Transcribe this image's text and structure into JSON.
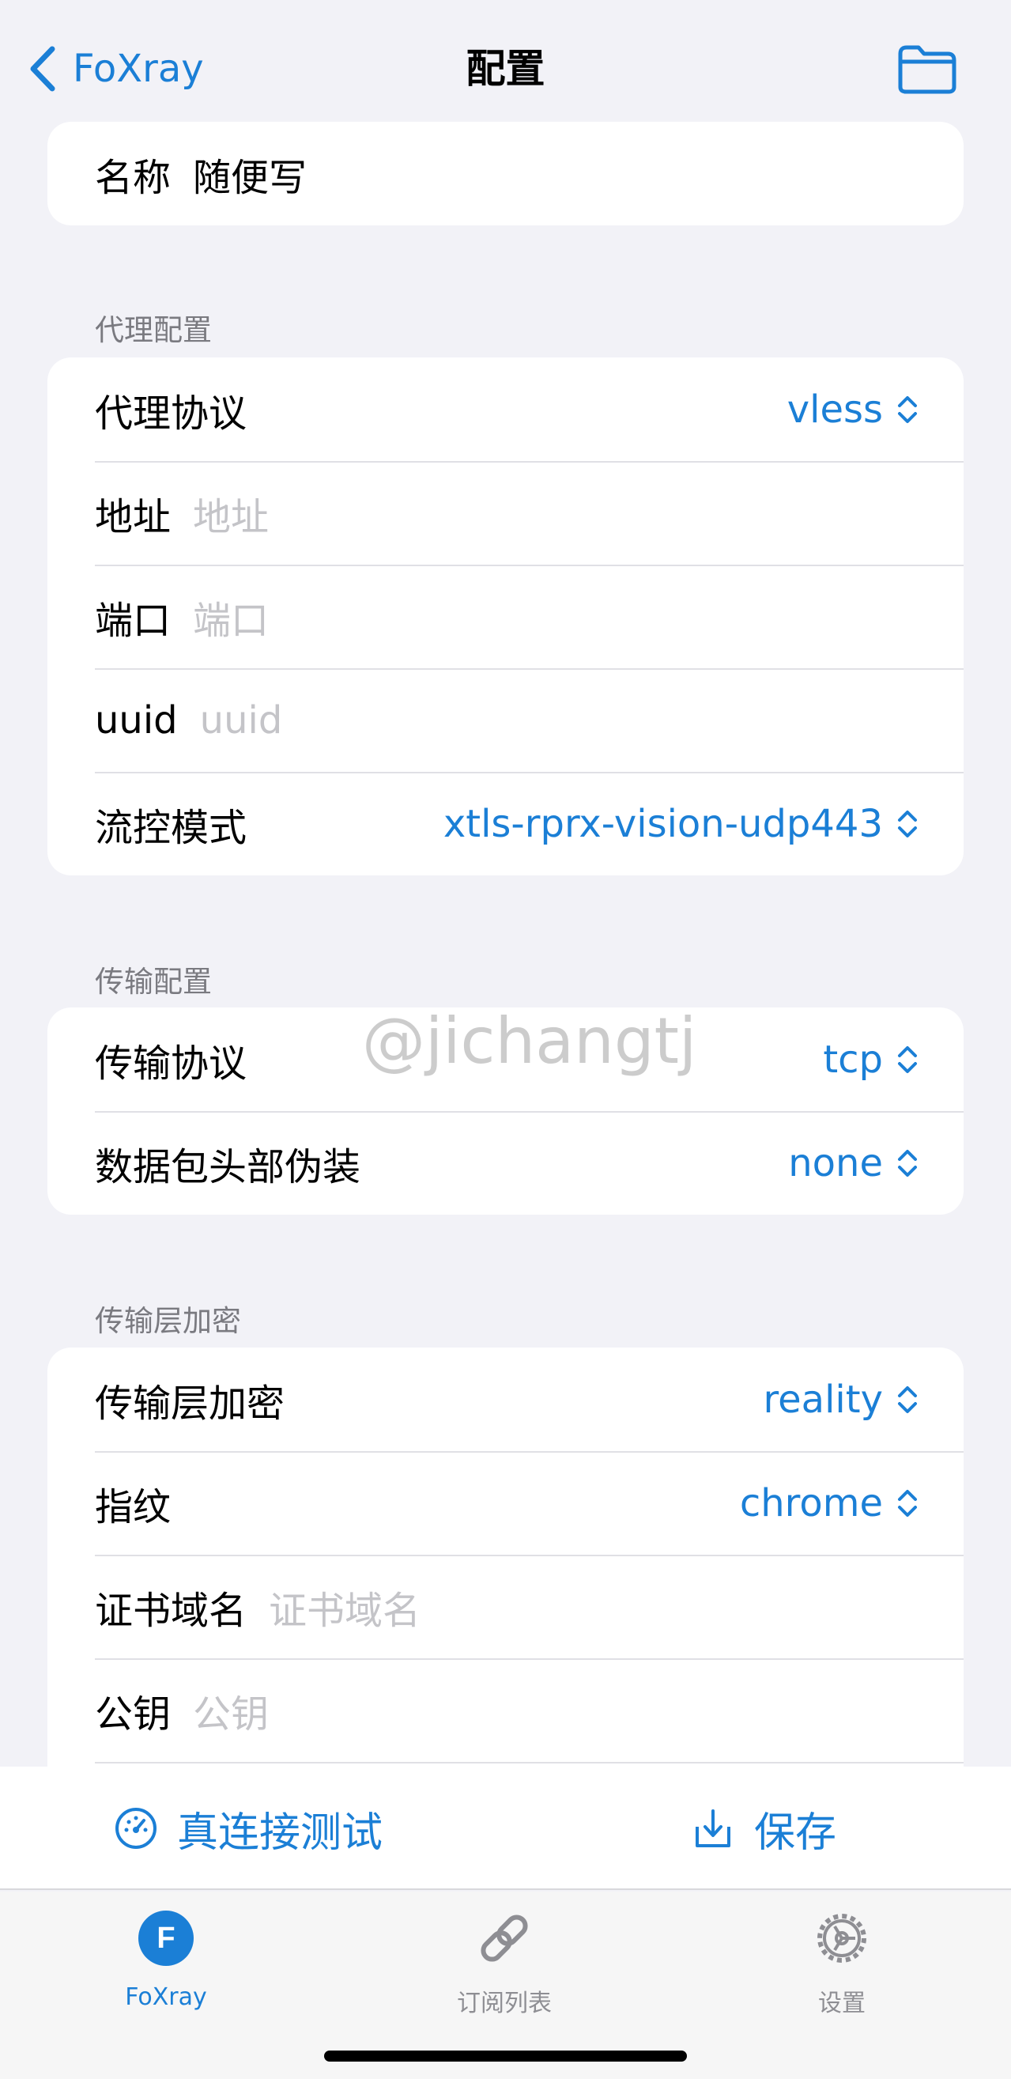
{
  "nav": {
    "back_label": "FoXray",
    "title": "配置"
  },
  "name_card": {
    "label": "名称",
    "value": "随便写"
  },
  "proxy_section": {
    "header": "代理配置",
    "rows": {
      "protocol": {
        "label": "代理协议",
        "value": "vless"
      },
      "address": {
        "label": "地址",
        "placeholder": "地址"
      },
      "port": {
        "label": "端口",
        "placeholder": "端口"
      },
      "uuid": {
        "label": "uuid",
        "placeholder": "uuid"
      },
      "flow": {
        "label": "流控模式",
        "value": "xtls-rprx-vision-udp443"
      }
    }
  },
  "transport_section": {
    "header": "传输配置",
    "rows": {
      "protocol": {
        "label": "传输协议",
        "value": "tcp"
      },
      "header_type": {
        "label": "数据包头部伪装",
        "value": "none"
      }
    }
  },
  "security_section": {
    "header": "传输层加密",
    "rows": {
      "security": {
        "label": "传输层加密",
        "value": "reality"
      },
      "fingerprint": {
        "label": "指纹",
        "value": "chrome"
      },
      "server_name": {
        "label": "证书域名",
        "placeholder": "证书域名"
      },
      "public_key": {
        "label": "公钥",
        "placeholder": "公钥"
      }
    }
  },
  "watermark": "@jichangtj",
  "actions": {
    "test_label": "真连接测试",
    "save_label": "保存"
  },
  "tabbar": {
    "items": [
      {
        "label": "FoXray",
        "icon": "foxray-f-icon",
        "letter": "F",
        "active": true
      },
      {
        "label": "订阅列表",
        "icon": "link-icon",
        "active": false
      },
      {
        "label": "设置",
        "icon": "gear-icon",
        "active": false
      }
    ]
  },
  "colors": {
    "accent": "#1b7fd6",
    "background": "#f2f2f7",
    "placeholder": "#c4c4c8",
    "secondary": "#8e8e93"
  }
}
